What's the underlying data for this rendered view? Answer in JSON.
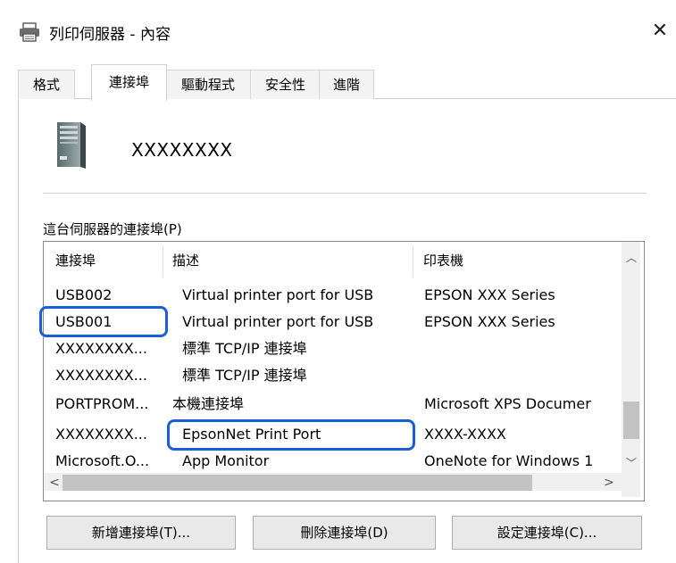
{
  "window": {
    "title": "列印伺服器 - 內容",
    "close_glyph": "✕"
  },
  "tabs": [
    {
      "label": "格式",
      "active": false
    },
    {
      "label": "連接埠",
      "active": true
    },
    {
      "label": "驅動程式",
      "active": false
    },
    {
      "label": "安全性",
      "active": false
    },
    {
      "label": "進階",
      "active": false
    }
  ],
  "server": {
    "name": "XXXXXXXX"
  },
  "ports_section": {
    "label": "這台伺服器的連接埠(P)"
  },
  "ports_list": {
    "columns": [
      "連接埠",
      "描述",
      "印表機"
    ],
    "rows": [
      {
        "port": "USB002",
        "description": "Virtual printer port for USB",
        "printer": "EPSON XXX Series"
      },
      {
        "port": "USB001",
        "description": "Virtual printer port for USB",
        "printer": "EPSON XXX Series"
      },
      {
        "port": "XXXXXXXX...",
        "description": "標準 TCP/IP 連接埠",
        "printer": ""
      },
      {
        "port": "XXXXXXXX...",
        "description": "標準 TCP/IP 連接埠",
        "printer": ""
      },
      {
        "port": "PORTPROM...",
        "description": "本機連接埠",
        "printer": "Microsoft XPS Documer"
      },
      {
        "port": "XXXXXXXX...",
        "description": "EpsonNet Print Port",
        "printer": "XXXX-XXXX"
      },
      {
        "port": "Microsoft.O...",
        "description": "App Monitor",
        "printer": "OneNote for Windows 1"
      }
    ]
  },
  "scroll": {
    "up_glyph": "︿",
    "down_glyph": "﹀",
    "left_glyph": "<",
    "right_glyph": ">"
  },
  "buttons": {
    "add": "新增連接埠(T)...",
    "delete": "刪除連接埠(D)",
    "configure": "設定連接埠(C)..."
  },
  "accent_color": "#1b5fd6"
}
